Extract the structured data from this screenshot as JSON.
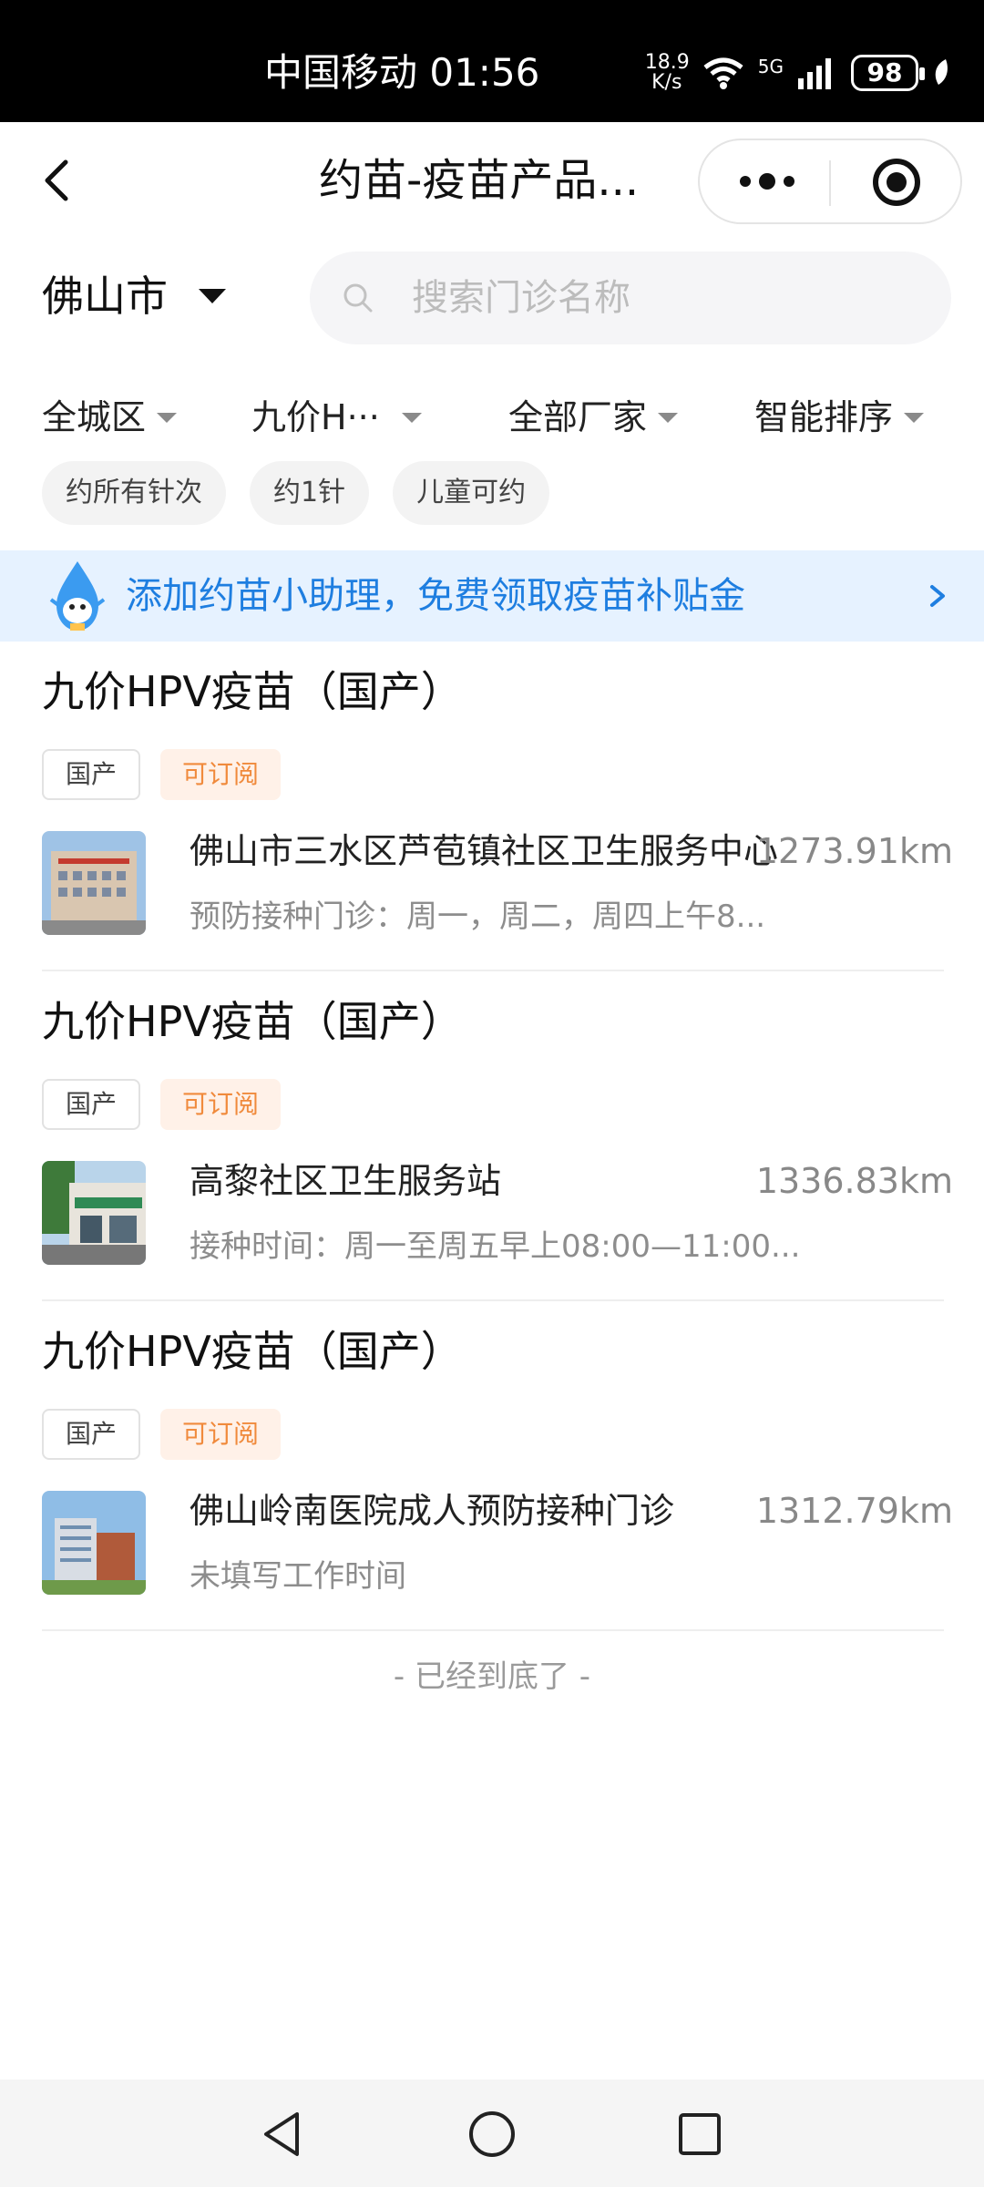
{
  "status_bar": {
    "carrier_time": "中国移动 01:56",
    "net_speed_value": "18.9",
    "net_speed_unit": "K/s",
    "network": "5G",
    "battery": "98"
  },
  "header": {
    "title": "约苗-疫苗产品..."
  },
  "location": {
    "city": "佛山市"
  },
  "search": {
    "placeholder": "搜索门诊名称"
  },
  "filters": [
    {
      "label": "全城区"
    },
    {
      "label": "九价H···"
    },
    {
      "label": "全部厂家"
    },
    {
      "label": "智能排序"
    }
  ],
  "chips": [
    {
      "label": "约所有针次"
    },
    {
      "label": "约1针"
    },
    {
      "label": "儿童可约"
    }
  ],
  "banner": {
    "text": "添加约苗小助理，免费领取疫苗补贴金"
  },
  "results": [
    {
      "title": "九价HPV疫苗（国产）",
      "tags": [
        "国产",
        "可订阅"
      ],
      "clinic": "佛山市三水区芦苞镇社区卫生服务中心",
      "distance": "1273.91km",
      "hours": "预防接种门诊：周一，周二，周四上午8..."
    },
    {
      "title": "九价HPV疫苗（国产）",
      "tags": [
        "国产",
        "可订阅"
      ],
      "clinic": "高黎社区卫生服务站",
      "distance": "1336.83km",
      "hours": "接种时间：周一至周五早上08:00—11:00..."
    },
    {
      "title": "九价HPV疫苗（国产）",
      "tags": [
        "国产",
        "可订阅"
      ],
      "clinic": "佛山岭南医院成人预防接种门诊",
      "distance": "1312.79km",
      "hours": "未填写工作时间"
    }
  ],
  "end_of_list": "- 已经到底了 -",
  "colors": {
    "accent_blue": "#1e7ee0",
    "banner_bg": "#e6f2ff",
    "subscribe_tag_text": "#f08a3c",
    "subscribe_tag_bg": "#fff1e8"
  },
  "icons": {
    "back": "back-arrow-icon",
    "more": "more-dots-icon",
    "close": "target-icon",
    "search": "search-icon",
    "banner": "water-drop-mascot-icon",
    "chevron": "chevron-right-icon",
    "nav_back": "nav-back-icon",
    "nav_home": "nav-home-icon",
    "nav_recent": "nav-recent-icon"
  }
}
